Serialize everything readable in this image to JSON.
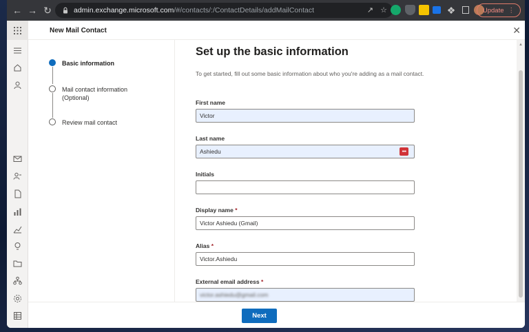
{
  "browser": {
    "url_domain": "admin.exchange.microsoft.com",
    "url_path": "/#/contacts/:/ContactDetails/addMailContact",
    "update_label": "Update"
  },
  "panel": {
    "title": "New Mail Contact"
  },
  "steps": [
    {
      "label": "Basic information",
      "state": "active"
    },
    {
      "label": "Mail contact information (Optional)",
      "state": "pending"
    },
    {
      "label": "Review mail contact",
      "state": "pending"
    }
  ],
  "form": {
    "title": "Set up the basic information",
    "description": "To get started, fill out some basic information about who you're adding as a mail contact.",
    "fields": {
      "first_name": {
        "label": "First name",
        "value": "Victor"
      },
      "last_name": {
        "label": "Last name",
        "value": "Ashiedu"
      },
      "initials": {
        "label": "Initials",
        "value": ""
      },
      "display_name": {
        "label": "Display name",
        "required_mark": "*",
        "value": "Victor Ashiedu (Gmail)"
      },
      "alias": {
        "label": "Alias",
        "required_mark": "*",
        "value": "Victor.Ashiedu"
      },
      "external_email": {
        "label": "External email address",
        "required_mark": "*",
        "value": "victor.ashiedu@gmail.com"
      }
    }
  },
  "footer": {
    "next_label": "Next"
  },
  "colors": {
    "accent": "#0f6cbd",
    "autofill_bg": "#e8f0fe",
    "required": "#a4262c"
  },
  "icons": [
    "waffle-icon",
    "menu-icon",
    "home-icon",
    "person-icon",
    "mail-icon",
    "contacts-icon",
    "document-icon",
    "reports-icon",
    "insights-icon",
    "lightbulb-icon",
    "folder-icon",
    "org-icon",
    "settings-icon",
    "table-icon"
  ]
}
